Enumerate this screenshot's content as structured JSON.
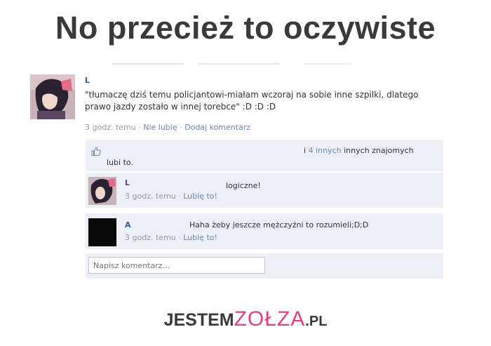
{
  "headline": "No przecież to oczywiste",
  "post": {
    "author": "L",
    "text": "\"tłumaczę dziś temu policjantowi-miałam wczoraj na sobie inne szpilki, dlatego prawo jazdy zostało w innej torebce\" :D :D :D",
    "time": "3 godz. temu",
    "unlike": "Nie lubię",
    "add_comment": "Dodaj komentarz",
    "separator": "·"
  },
  "likes": {
    "icon": "thumbs-up-icon",
    "and_text": "i",
    "others_link": "4 innych",
    "friends_text": "innych znajomych",
    "likes_text": "lubi to."
  },
  "comments": [
    {
      "author": "L",
      "text": "logiczne!",
      "time": "3 godz. temu",
      "like": "Lubię to!"
    },
    {
      "author": "A",
      "text": "Haha żeby jeszcze mężczyźni to rozumieli;D;D",
      "time": "3 godz. temu",
      "like": "Lubię to!"
    }
  ],
  "comment_input": {
    "placeholder": "Napisz komentarz..."
  },
  "logo": {
    "part1": "JESTEM",
    "part2": "ZOŁZA",
    "part3": ".PL"
  },
  "colors": {
    "link": "#6d84b4",
    "name": "#3b5998",
    "comment_bg": "#eceff5",
    "logo_accent": "#e0407f"
  }
}
